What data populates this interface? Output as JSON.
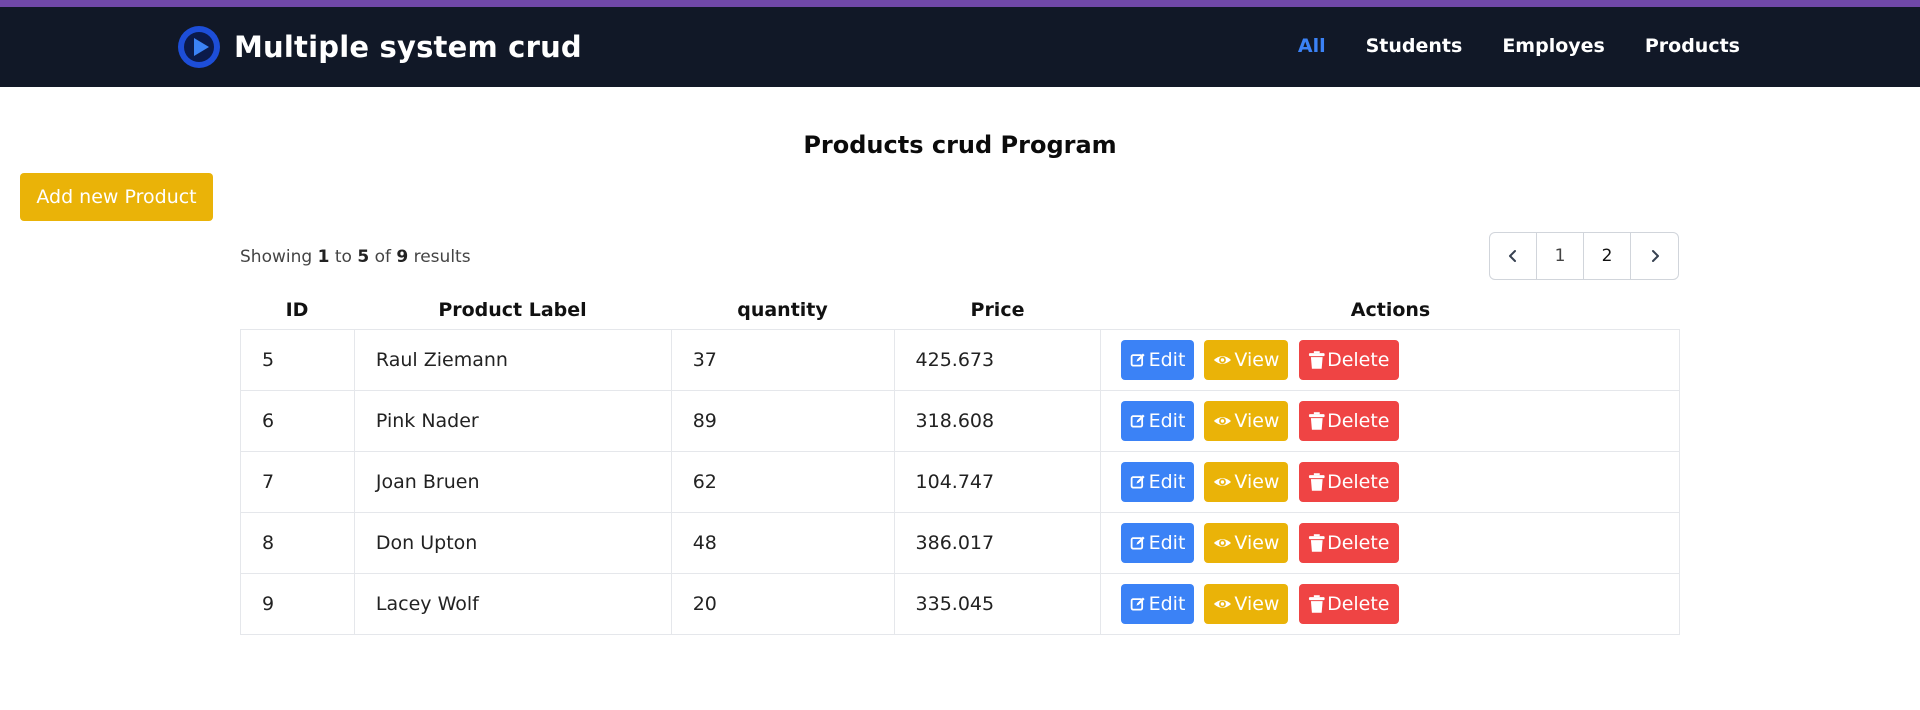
{
  "header": {
    "brand": "Multiple system crud",
    "nav": [
      {
        "label": "All",
        "active": true
      },
      {
        "label": "Students",
        "active": false
      },
      {
        "label": "Employes",
        "active": false
      },
      {
        "label": "Products",
        "active": false
      }
    ]
  },
  "main": {
    "title": "Products crud Program",
    "add_button": "Add new Product",
    "showing": {
      "prefix": "Showing",
      "from": "1",
      "to_word": "to",
      "to": "5",
      "of_word": "of",
      "total": "9",
      "suffix": "results"
    },
    "pagination": {
      "pages": [
        "1",
        "2"
      ],
      "current": "2"
    },
    "table": {
      "headers": [
        "ID",
        "Product Label",
        "quantity",
        "Price",
        "Actions"
      ],
      "rows": [
        {
          "id": "5",
          "label": "Raul Ziemann",
          "quantity": "37",
          "price": "425.673"
        },
        {
          "id": "6",
          "label": "Pink Nader",
          "quantity": "89",
          "price": "318.608"
        },
        {
          "id": "7",
          "label": "Joan Bruen",
          "quantity": "62",
          "price": "104.747"
        },
        {
          "id": "8",
          "label": "Don Upton",
          "quantity": "48",
          "price": "386.017"
        },
        {
          "id": "9",
          "label": "Lacey Wolf",
          "quantity": "20",
          "price": "335.045"
        }
      ],
      "actions": {
        "edit": "Edit",
        "view": "View",
        "delete": "Delete"
      }
    }
  },
  "colors": {
    "navbar": "#111827",
    "top_stripe": "#7048a8",
    "active_nav": "#3b82f6",
    "add_button": "#eab308",
    "edit_button": "#3b82f6",
    "view_button": "#eab308",
    "delete_button": "#ef4444"
  },
  "icons": {
    "logo": "play-logo-icon",
    "prev": "chevron-left-icon",
    "next": "chevron-right-icon",
    "edit": "edit-icon",
    "view": "eye-icon",
    "delete": "trash-icon"
  }
}
